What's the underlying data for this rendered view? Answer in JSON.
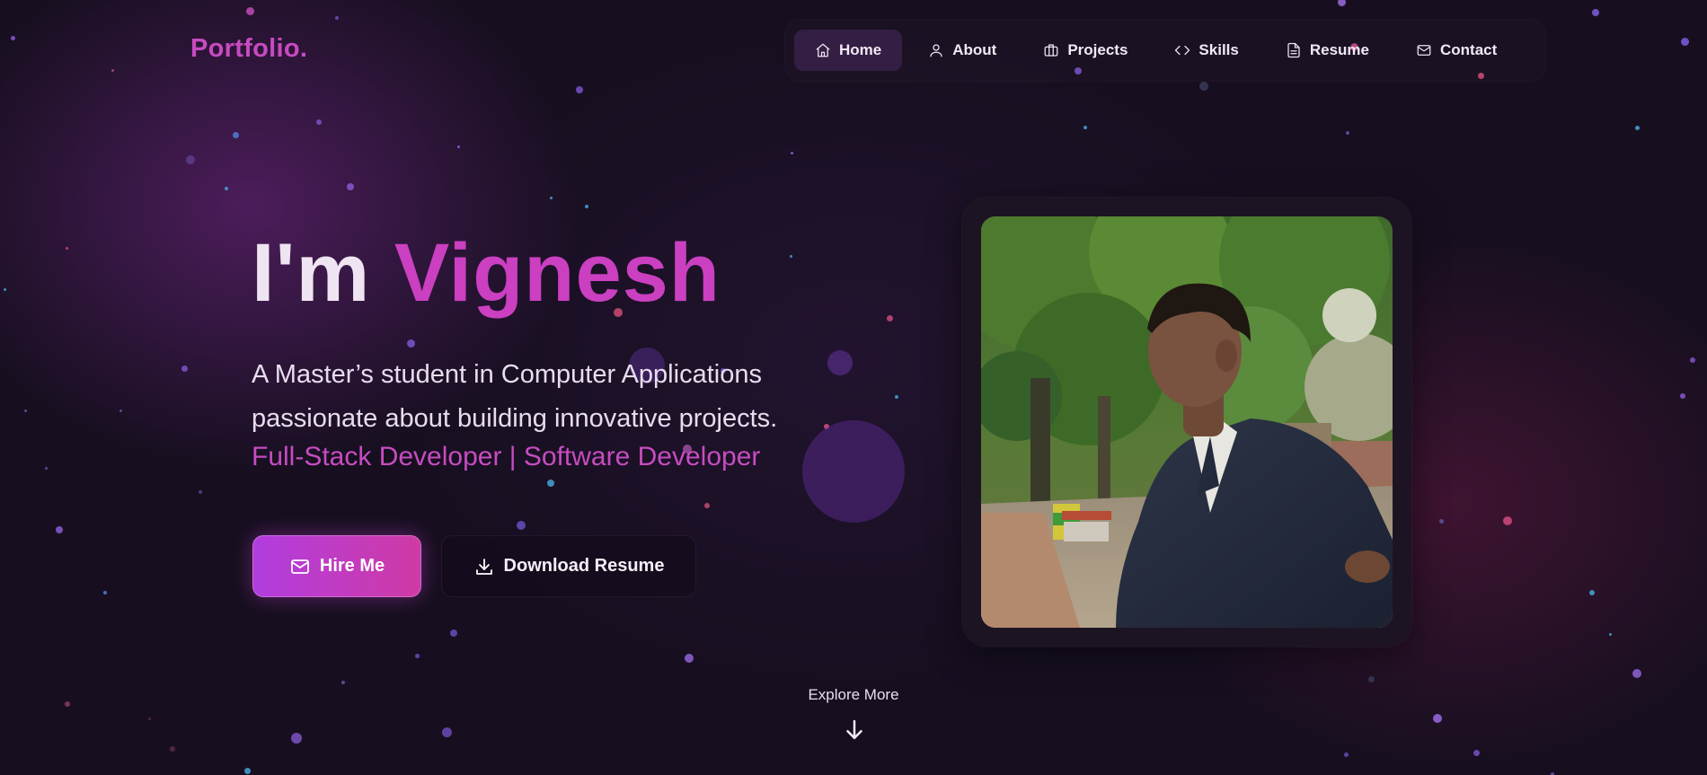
{
  "header": {
    "logo": "Portfolio.",
    "nav": [
      {
        "label": "Home",
        "icon": "home-icon",
        "active": true
      },
      {
        "label": "About",
        "icon": "user-icon",
        "active": false
      },
      {
        "label": "Projects",
        "icon": "briefcase-icon",
        "active": false
      },
      {
        "label": "Skills",
        "icon": "code-icon",
        "active": false
      },
      {
        "label": "Resume",
        "icon": "document-icon",
        "active": false
      },
      {
        "label": "Contact",
        "icon": "mail-icon",
        "active": false
      }
    ]
  },
  "hero": {
    "greeting": "I'm",
    "name": "Vignesh",
    "description": "A Master’s student in Computer Applications passionate about building innovative projects.",
    "roles": "Full-Stack Developer | Software Developer",
    "hire_label": "Hire Me",
    "hire_icon": "mail-icon",
    "download_label": "Download Resume",
    "download_icon": "download-icon"
  },
  "explore": {
    "label": "Explore More",
    "icon": "arrow-down-icon"
  },
  "colors": {
    "accent": "#cb3fc1",
    "background": "#170f20",
    "button_gradient_start": "#b13ddf",
    "button_gradient_end": "#cf3aa5"
  }
}
